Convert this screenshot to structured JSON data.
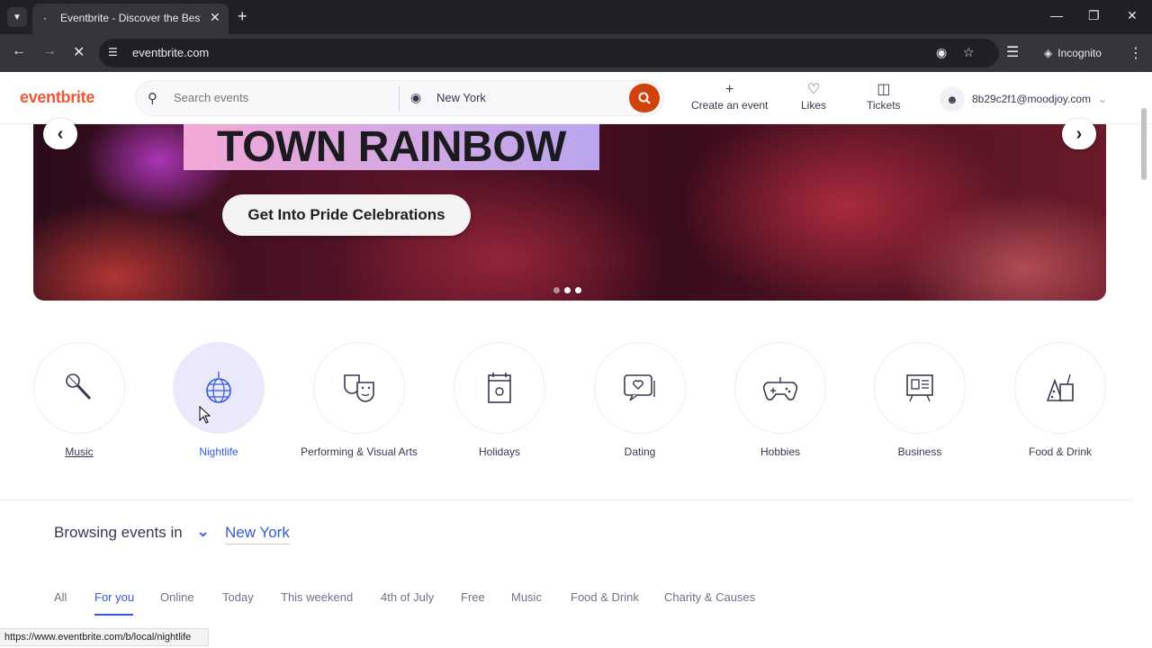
{
  "browser": {
    "tab_title": "Eventbrite - Discover the Best L",
    "url": "eventbrite.com",
    "incognito_label": "Incognito",
    "status_url": "https://www.eventbrite.com/b/local/nightlife"
  },
  "header": {
    "logo": "eventbrite",
    "search_placeholder": "Search events",
    "location": "New York",
    "create_label": "Create an event",
    "likes_label": "Likes",
    "tickets_label": "Tickets",
    "account_email": "8b29c2f1@moodjoy.com"
  },
  "hero": {
    "title": "TOWN RAINBOW",
    "cta": "Get Into Pride Celebrations",
    "slide_count": 3,
    "active_slide": 2
  },
  "categories": [
    {
      "label": "Music",
      "icon": "microphone-icon"
    },
    {
      "label": "Nightlife",
      "icon": "disco-ball-icon"
    },
    {
      "label": "Performing & Visual Arts",
      "icon": "theater-masks-icon"
    },
    {
      "label": "Holidays",
      "icon": "calendar-icon"
    },
    {
      "label": "Dating",
      "icon": "chat-heart-icon"
    },
    {
      "label": "Hobbies",
      "icon": "gamepad-icon"
    },
    {
      "label": "Business",
      "icon": "presentation-icon"
    },
    {
      "label": "Food & Drink",
      "icon": "food-drink-icon"
    }
  ],
  "browsing": {
    "prefix": "Browsing events in",
    "city": "New York"
  },
  "filters": [
    "All",
    "For you",
    "Online",
    "Today",
    "This weekend",
    "4th of July",
    "Free",
    "Music",
    "Food & Drink",
    "Charity & Causes"
  ],
  "colors": {
    "brand": "#f05537",
    "accent": "#3659e3"
  }
}
